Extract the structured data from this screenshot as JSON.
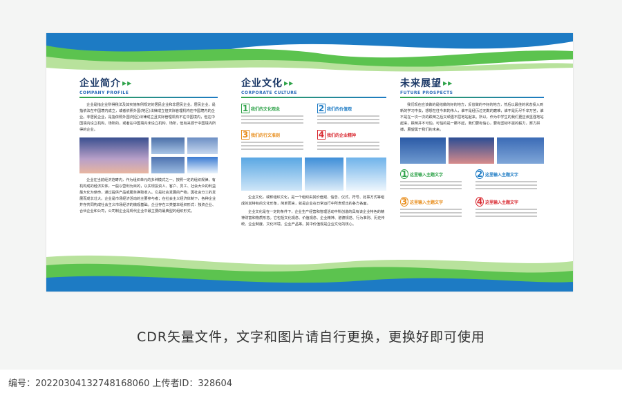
{
  "panels": {
    "company": {
      "title": "企业简介",
      "subtitle": "COMPANY PROFILE",
      "para1": "企业是指企业所得税法及其实施条例规定的居民企业和非居民企业。居民企业，是指依法在中国境内成立，或者依照外国(地区)法律成立但实际管理机构在中国境内的企业。非居民企业，是指依照外国(地区)法律成立且实际管理机构不在中国境内，但在中国境内设立机构、场所的，或者在中国境内未设立机构、场所，但有来源于中国境内所得的企业。",
      "para2": "企业在当前经济范畴内，作为组织单元的多种模式之一，按照一定的组织规律，有机构成的经济实体，一般以营利为目的，以实现投资人、客户、员工、社会大众的利益最大化为使命，通过提供产品或服务换取收入。它是社会发展的产物，因社会分工的发展而成长壮大。企业是市场经济活动的主要参与者；在社会主义经济体制下，各种企业并存共同构成社会主义市场经济的微观基础。企业存在三类基本组织形式：独资企业、合伙企业和公司，公司制企业是现代企业中最主要的最典型的组织形式。"
    },
    "culture": {
      "title": "企业文化",
      "subtitle": "CORPORATE CULTURE",
      "items": [
        {
          "num": "1",
          "label": "我们的文化观念"
        },
        {
          "num": "2",
          "label": "我们的价值观"
        },
        {
          "num": "3",
          "label": "我们的行文准则"
        },
        {
          "num": "4",
          "label": "我们的企业精神"
        }
      ],
      "para1": "企业文化，或称组织文化，是一个组织由其价值观、信念、仪式、符号、处事方式等组成的其特有的文化形象，简单而言，就是企业在日常运行中所表现出的各方各面。",
      "para2": "企业文化是在一定的条件下，企业生产经营和管理活动中所创造的具有该企业特色的精神财富和物质形态。它包括文化观念、价值观念、企业精神、道德规范、行为准则、历史传统、企业制度、文化环境、企业产品等。其中价值观是企业文化的核心。"
    },
    "future": {
      "title": "未来展望",
      "subtitle": "FUTURE PROSPECTS",
      "para1": "我们现在应该做的是结做的好的地方，反省做的不好的地方，然后以最佳的状态投入到新的学习中去，想想在往今来的伟人，谁不是经历过无数的磨难，谁不是历尽千辛万苦，谁不是在一次一次的跌倒之后又顽强不屈地站起来。所以，作为中学生的我们更应该坚强地站起来，跌倒并不可怕，可怕的是一蹶不起，我们要有信心，要有坚韧不拔的毅力，努力拼搏，展望属于我们的未来。",
      "items": [
        {
          "num": "1",
          "label": "这里输入主题文字"
        },
        {
          "num": "2",
          "label": "这里输入主题文字"
        },
        {
          "num": "3",
          "label": "这里输入主题文字"
        },
        {
          "num": "4",
          "label": "这里输入主题文字"
        }
      ]
    }
  },
  "caption": "CDR矢量文件，文字和图片请自行更换，更换好即可使用",
  "meta": "编号：20220304132748168060 上传者ID：328604",
  "colors": {
    "green": "#2fa34a",
    "blue": "#1d7bc4",
    "orange": "#e88d1b",
    "red": "#d8282f",
    "navy": "#1d3a68"
  }
}
